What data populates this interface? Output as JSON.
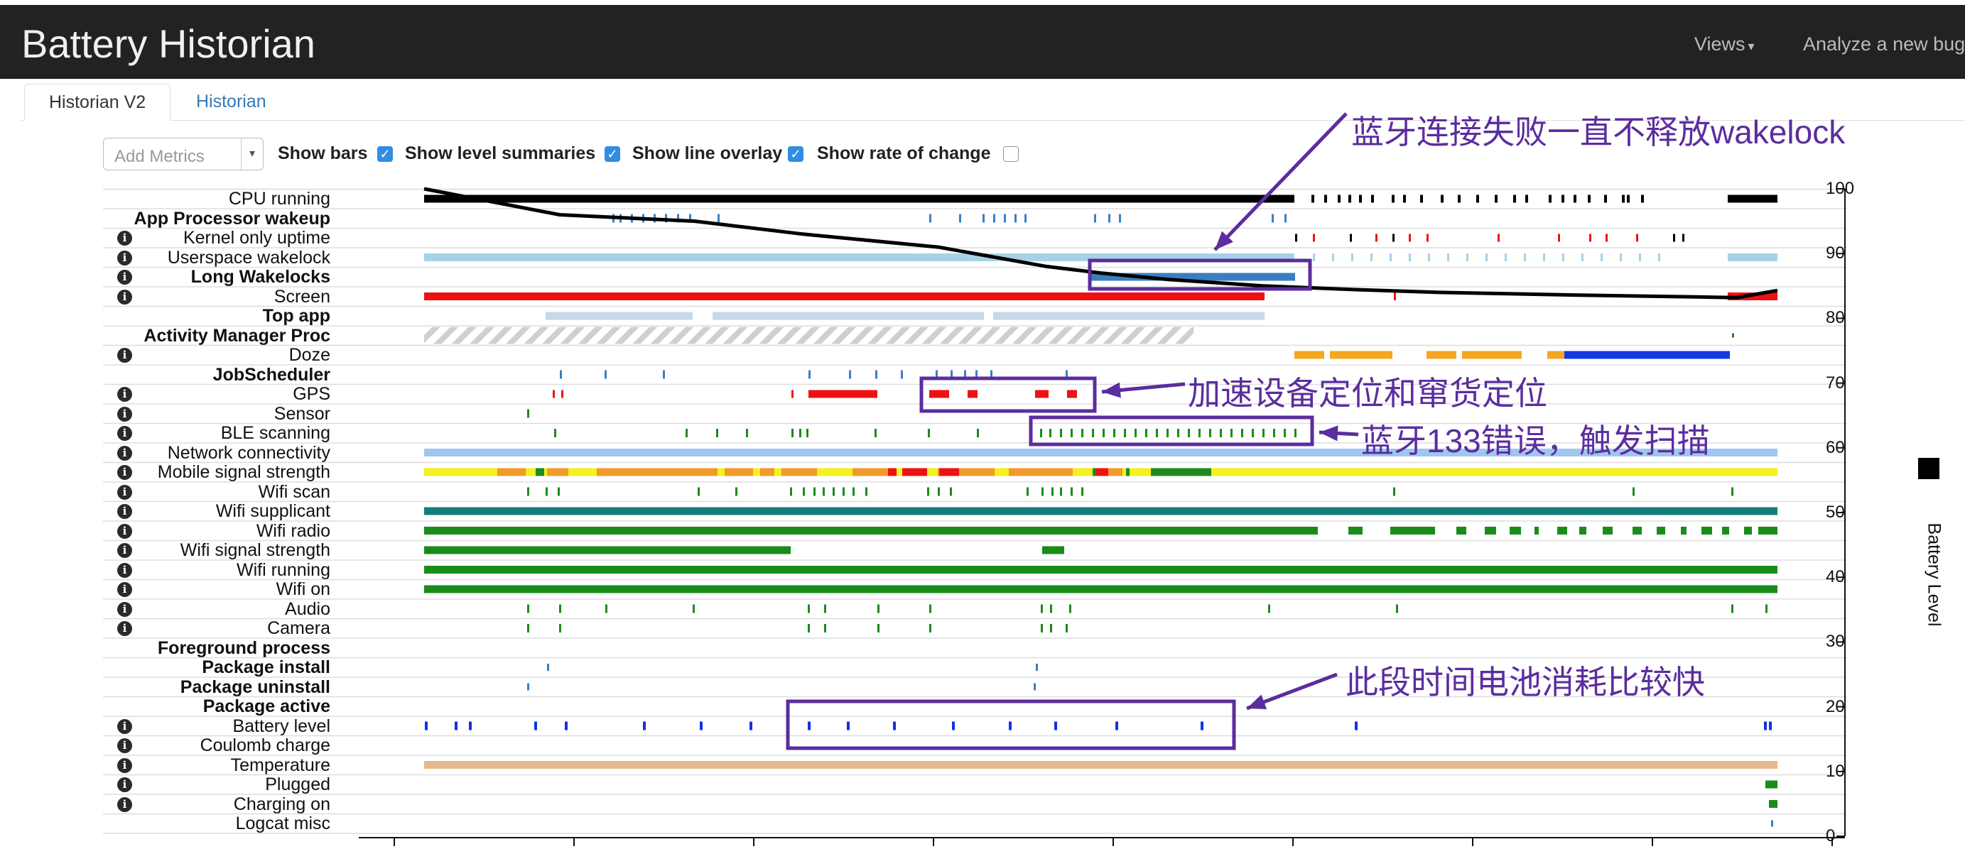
{
  "navbar": {
    "brand": "Battery Historian",
    "views_label": "Views",
    "analyze_label": "Analyze a new bug"
  },
  "tabs": [
    {
      "label": "Historian V2",
      "active": true
    },
    {
      "label": "Historian",
      "active": false
    }
  ],
  "controls": {
    "add_metrics_placeholder": "Add Metrics",
    "show_bars": {
      "label": "Show bars",
      "checked": true
    },
    "show_level_summaries": {
      "label": "Show level summaries",
      "checked": true
    },
    "show_line_overlay": {
      "label": "Show line overlay",
      "checked": true
    },
    "show_rate_of_change": {
      "label": "Show rate of change",
      "checked": false
    }
  },
  "rows": [
    {
      "label": "CPU running",
      "bold": false,
      "info": false
    },
    {
      "label": "App Processor wakeup",
      "bold": true,
      "info": false
    },
    {
      "label": "Kernel only uptime",
      "bold": false,
      "info": true
    },
    {
      "label": "Userspace wakelock",
      "bold": false,
      "info": true
    },
    {
      "label": "Long Wakelocks",
      "bold": true,
      "info": true
    },
    {
      "label": "Screen",
      "bold": false,
      "info": true
    },
    {
      "label": "Top app",
      "bold": true,
      "info": false
    },
    {
      "label": "Activity Manager Proc",
      "bold": true,
      "info": false
    },
    {
      "label": "Doze",
      "bold": false,
      "info": true
    },
    {
      "label": "JobScheduler",
      "bold": true,
      "info": false
    },
    {
      "label": "GPS",
      "bold": false,
      "info": true
    },
    {
      "label": "Sensor",
      "bold": false,
      "info": true
    },
    {
      "label": "BLE scanning",
      "bold": false,
      "info": true
    },
    {
      "label": "Network connectivity",
      "bold": false,
      "info": true
    },
    {
      "label": "Mobile signal strength",
      "bold": false,
      "info": true
    },
    {
      "label": "Wifi scan",
      "bold": false,
      "info": true
    },
    {
      "label": "Wifi supplicant",
      "bold": false,
      "info": true
    },
    {
      "label": "Wifi radio",
      "bold": false,
      "info": true
    },
    {
      "label": "Wifi signal strength",
      "bold": false,
      "info": true
    },
    {
      "label": "Wifi running",
      "bold": false,
      "info": true
    },
    {
      "label": "Wifi on",
      "bold": false,
      "info": true
    },
    {
      "label": "Audio",
      "bold": false,
      "info": true
    },
    {
      "label": "Camera",
      "bold": false,
      "info": true
    },
    {
      "label": "Foreground process",
      "bold": true,
      "info": false
    },
    {
      "label": "Package install",
      "bold": true,
      "info": false
    },
    {
      "label": "Package uninstall",
      "bold": true,
      "info": false
    },
    {
      "label": "Package active",
      "bold": true,
      "info": false
    },
    {
      "label": "Battery level",
      "bold": false,
      "info": true
    },
    {
      "label": "Coulomb charge",
      "bold": false,
      "info": true
    },
    {
      "label": "Temperature",
      "bold": false,
      "info": true
    },
    {
      "label": "Plugged",
      "bold": false,
      "info": true
    },
    {
      "label": "Charging on",
      "bold": false,
      "info": true
    },
    {
      "label": "Logcat misc",
      "bold": false,
      "info": false
    }
  ],
  "chart_data": {
    "type": "line",
    "ylabel": "Battery Level",
    "ylim": [
      0,
      100
    ],
    "yticks": [
      "100",
      "90",
      "80",
      "70",
      "60",
      "50",
      "40",
      "30",
      "20",
      "10",
      "0"
    ],
    "x_range": [
      0,
      1
    ],
    "battery_level": {
      "x": [
        0.0,
        0.05,
        0.1,
        0.2,
        0.28,
        0.38,
        0.46,
        0.5,
        0.55,
        0.62,
        0.68,
        0.75,
        0.85,
        0.94,
        0.97,
        1.0
      ],
      "y": [
        100,
        98,
        96,
        95,
        93,
        91,
        88,
        87,
        86,
        85,
        84.5,
        84,
        83.6,
        83.3,
        83.2,
        84.3
      ]
    }
  },
  "colors": {
    "cpu": "#000000",
    "wakeup": "#3b7fc4",
    "userspace": "#a8d0e8",
    "long_wakelock": "#3a7ebf",
    "screen": "#ee1111",
    "top_app": "#c5d8ec",
    "doze_light": "#f5a623",
    "doze_deep": "#1438e0",
    "gps": "#ee1111",
    "green": "#198c19",
    "network": "#9fc7ee",
    "wifi_supplicant": "#137c7c",
    "battery_tick": "#1130e8",
    "temperature": "#e5b88d",
    "annotation": "#5b2d9e"
  },
  "annotations": [
    {
      "text": "蓝牙连接失败一直不释放wakelock"
    },
    {
      "text": "加速设备定位和窜货定位"
    },
    {
      "text": "蓝牙133错误，触发扫描"
    },
    {
      "text": "此段时间电池消耗比较快"
    }
  ]
}
